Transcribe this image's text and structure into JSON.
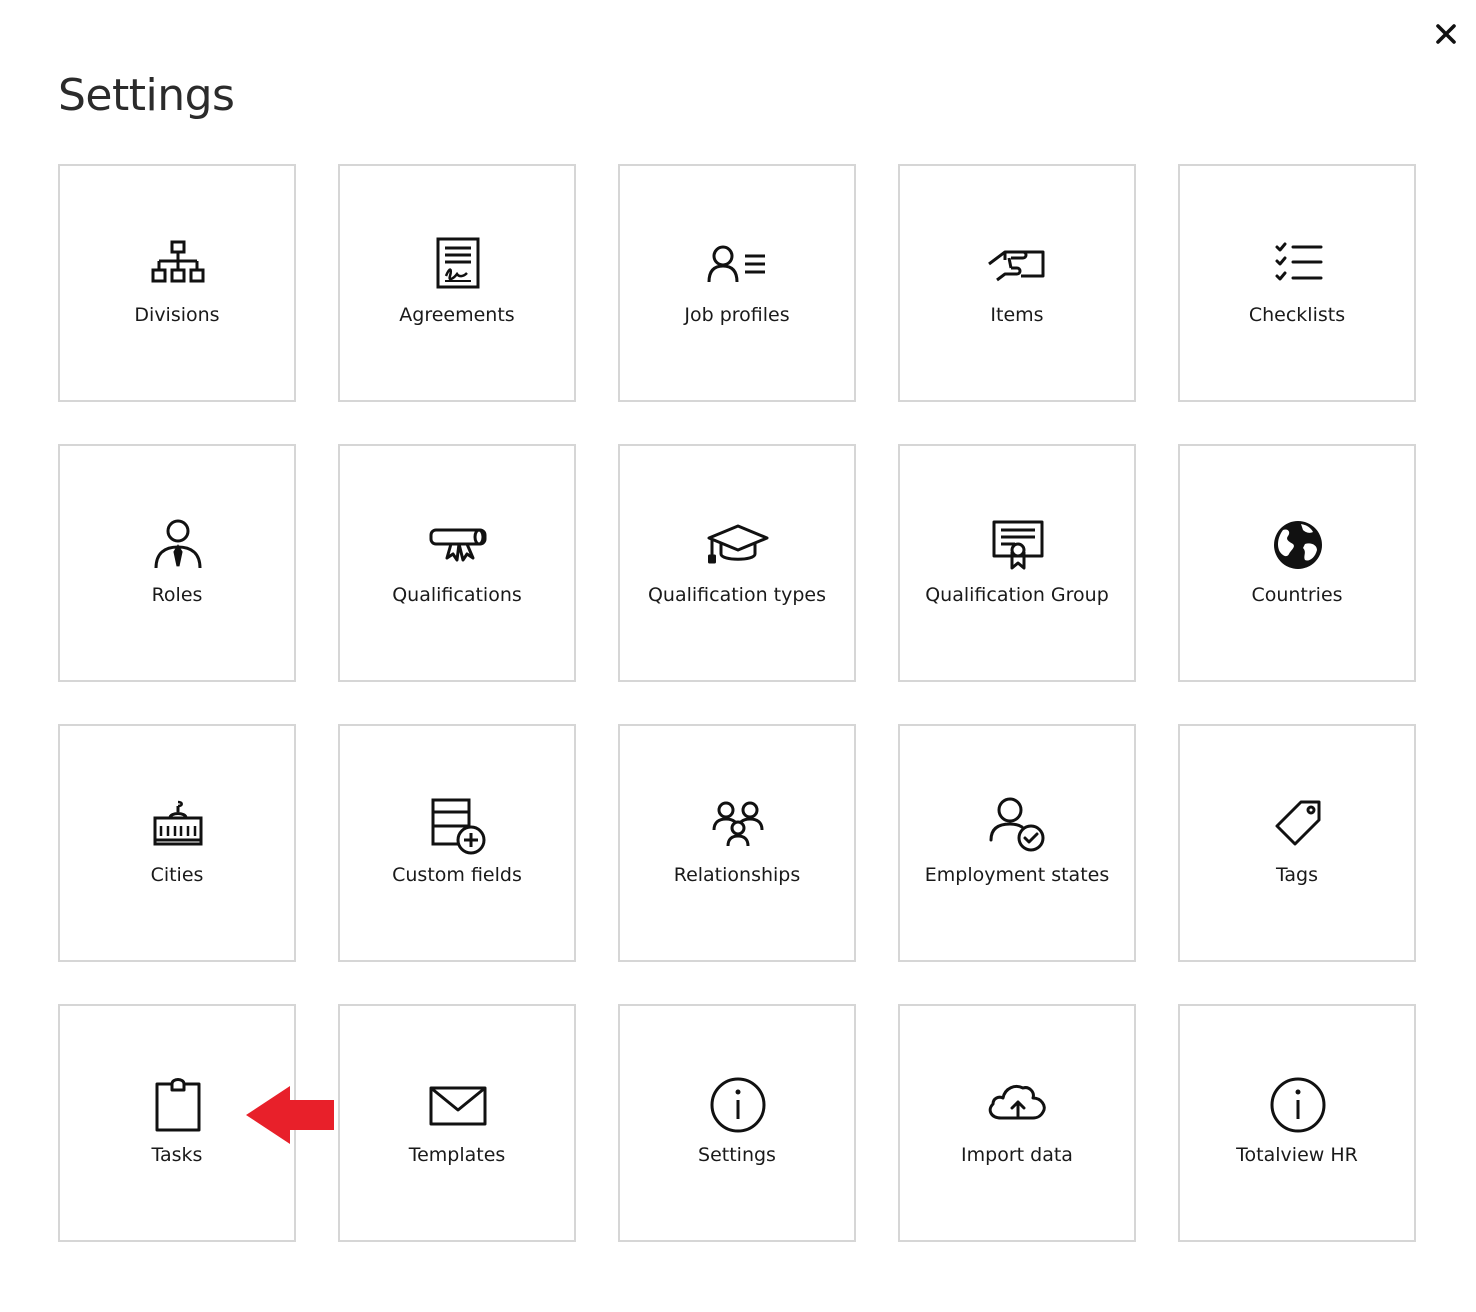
{
  "header": {
    "title": "Settings",
    "close_icon": "close-icon"
  },
  "tiles": [
    {
      "label": "Divisions",
      "icon": "org-chart-icon"
    },
    {
      "label": "Agreements",
      "icon": "signed-document-icon"
    },
    {
      "label": "Job profiles",
      "icon": "person-list-icon"
    },
    {
      "label": "Items",
      "icon": "hand-card-icon"
    },
    {
      "label": "Checklists",
      "icon": "checklist-icon"
    },
    {
      "label": "Roles",
      "icon": "person-tie-icon"
    },
    {
      "label": "Qualifications",
      "icon": "diploma-icon"
    },
    {
      "label": "Qualification types",
      "icon": "graduation-cap-icon"
    },
    {
      "label": "Qualification Group",
      "icon": "certificate-icon"
    },
    {
      "label": "Countries",
      "icon": "globe-icon"
    },
    {
      "label": "Cities",
      "icon": "city-hall-icon"
    },
    {
      "label": "Custom fields",
      "icon": "form-add-icon"
    },
    {
      "label": "Relationships",
      "icon": "people-group-icon"
    },
    {
      "label": "Employment states",
      "icon": "person-check-icon"
    },
    {
      "label": "Tags",
      "icon": "tag-icon"
    },
    {
      "label": "Tasks",
      "icon": "clipboard-icon"
    },
    {
      "label": "Templates",
      "icon": "envelope-icon"
    },
    {
      "label": "Settings",
      "icon": "info-icon"
    },
    {
      "label": "Import data",
      "icon": "cloud-upload-icon"
    },
    {
      "label": "Totalview HR",
      "icon": "info-icon"
    }
  ],
  "annotation": {
    "icon": "arrow-left-icon",
    "color": "#e8202a"
  }
}
